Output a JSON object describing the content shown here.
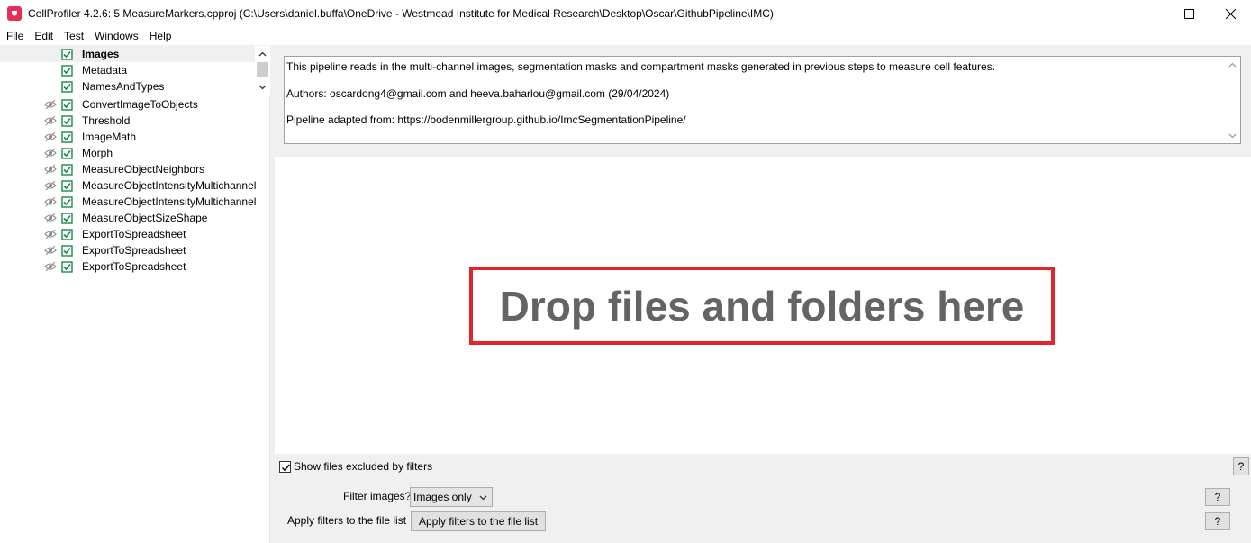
{
  "window": {
    "title": "CellProfiler 4.2.6: 5 MeasureMarkers.cpproj (C:\\Users\\daniel.buffa\\OneDrive - Westmead Institute for Medical Research\\Desktop\\Oscar\\GithubPipeline\\IMC)"
  },
  "menu": {
    "file": "File",
    "edit": "Edit",
    "test": "Test",
    "windows": "Windows",
    "help": "Help"
  },
  "input_modules": [
    {
      "label": "Images",
      "selected": true
    },
    {
      "label": "Metadata"
    },
    {
      "label": "NamesAndTypes"
    }
  ],
  "pipeline_modules": [
    {
      "label": "ConvertImageToObjects"
    },
    {
      "label": "Threshold"
    },
    {
      "label": "ImageMath"
    },
    {
      "label": "Morph"
    },
    {
      "label": "MeasureObjectNeighbors"
    },
    {
      "label": "MeasureObjectIntensityMultichannel"
    },
    {
      "label": "MeasureObjectIntensityMultichannel"
    },
    {
      "label": "MeasureObjectSizeShape"
    },
    {
      "label": "ExportToSpreadsheet"
    },
    {
      "label": "ExportToSpreadsheet"
    },
    {
      "label": "ExportToSpreadsheet"
    }
  ],
  "notes": {
    "line1": "This pipeline reads in the multi-channel images, segmentation masks and compartment masks generated in previous steps to measure cell features.",
    "line2": "Authors: oscardong4@gmail.com and heeva.baharlou@gmail.com (29/04/2024)",
    "line3": "Pipeline adapted from: https://bodenmillergroup.github.io/ImcSegmentationPipeline/"
  },
  "dropzone": {
    "text": "Drop files and folders here"
  },
  "bottom": {
    "show_excluded_label": "Show files excluded by filters",
    "show_excluded_checked": true,
    "filter_images_label": "Filter images?",
    "filter_images_value": "Images only",
    "apply_filters_label": "Apply filters to the file list",
    "apply_filters_button": "Apply filters to the file list",
    "help_label": "?"
  },
  "colors": {
    "accent_red": "#e3242b",
    "check_green": "#1a8a4a",
    "app_icon": "#e0305a"
  }
}
